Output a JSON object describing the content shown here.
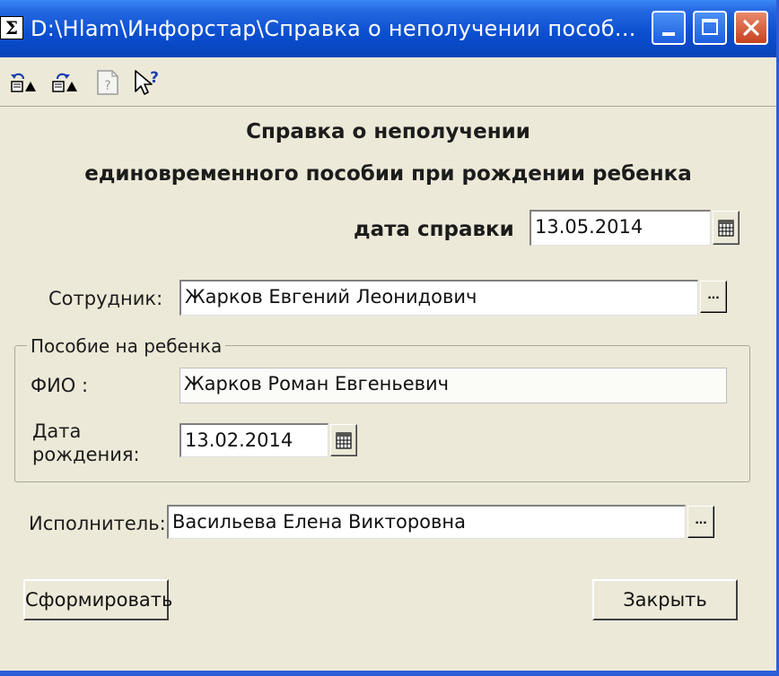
{
  "window": {
    "title": "D:\\Hlam\\Инфорстар\\Справка о неполучении пособ...",
    "app_icon_glyph": "Σ"
  },
  "titlebar_buttons": [
    "minimize",
    "maximize",
    "close"
  ],
  "toolbar": {
    "icons": [
      "undo-icon",
      "redo-icon",
      "help-page-icon",
      "whats-this-help-icon"
    ]
  },
  "form": {
    "heading_line1": "Справка о  неполучении",
    "heading_line2": "единовременного пособии при рождении ребенка",
    "date_label": "дата справки",
    "date_value": "13.05.2014",
    "employee_label": "Сотрудник:",
    "employee_value": "Жарков Евгений Леонидович",
    "ellipsis": "...",
    "group_title": "Пособие на ребенка",
    "fio_label": "ФИО :",
    "fio_value": "Жарков Роман Евгеньевич",
    "birth_label_line1": "Дата",
    "birth_label_line2": "рождения:",
    "birth_value": "13.02.2014",
    "executor_label": "Исполнитель:",
    "executor_value": "Васильева Елена Викторовна"
  },
  "buttons": {
    "generate": "Сформировать",
    "close": "Закрыть"
  }
}
